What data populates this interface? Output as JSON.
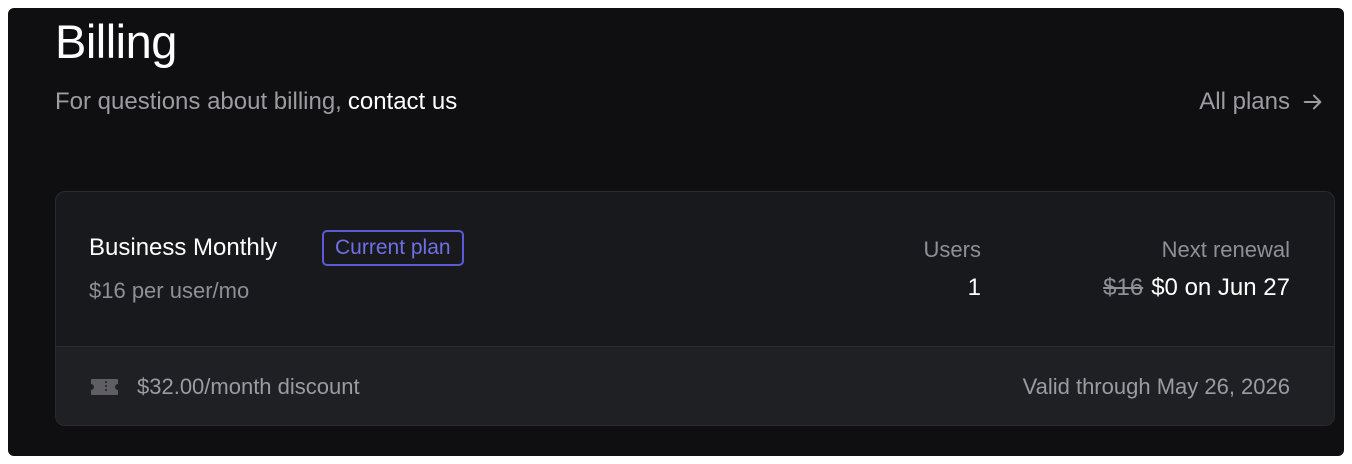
{
  "header": {
    "title": "Billing",
    "subtitle_text": "For questions about billing,",
    "contact_link": "contact us",
    "all_plans_link": "All plans",
    "arrow_icon": "arrow-right-icon"
  },
  "plan": {
    "name": "Business Monthly",
    "badge": "Current plan",
    "price": "$16 per user/mo",
    "users_label": "Users",
    "users_value": "1",
    "renewal_label": "Next renewal",
    "renewal_old_price": "$16",
    "renewal_new": "$0 on Jun 27"
  },
  "discount": {
    "icon": "ticket-icon",
    "text": "$32.00/month discount",
    "valid": "Valid through May 26, 2026"
  },
  "colors": {
    "background": "#0f0f11",
    "card": "#18191c",
    "accent": "#5b5bd6"
  }
}
